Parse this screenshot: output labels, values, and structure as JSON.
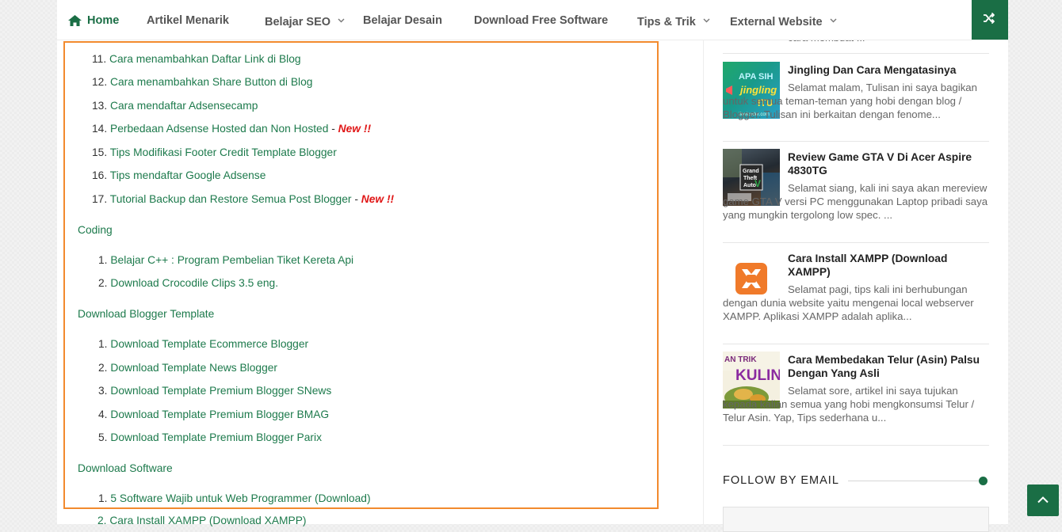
{
  "nav": {
    "home": "Home",
    "items": [
      "Artikel Menarik",
      "Belajar SEO",
      "Belajar Desain",
      "Download Free Software",
      "Tips & Trik",
      "External Website"
    ]
  },
  "content": {
    "list1": [
      {
        "num": "11.",
        "text": "Cara menambahkan Daftar Link di Blog"
      },
      {
        "num": "12.",
        "text": "Cara menambahkan Share Button di Blog"
      },
      {
        "num": "13.",
        "text": "Cara mendaftar Adsensecamp"
      },
      {
        "num": "14.",
        "text": "Perbedaan Adsense Hosted dan Non Hosted",
        "dash": " - ",
        "tag": "New !!"
      },
      {
        "num": "15.",
        "text": "Tips Modifikasi Footer Credit Template Blogger"
      },
      {
        "num": "16.",
        "text": "Tips mendaftar Google Adsense"
      },
      {
        "num": "17.",
        "text": "Tutorial Backup dan Restore Semua Post Blogger",
        "dash": " - ",
        "tag": "New !!"
      }
    ],
    "section_coding": "Coding",
    "coding": [
      {
        "num": "1.",
        "text": "Belajar C++ : Program Pembelian Tiket Kereta Api"
      },
      {
        "num": "2.",
        "text": "Download Crocodile Clips 3.5 eng."
      }
    ],
    "section_template": "Download Blogger Template",
    "templates": [
      {
        "num": "1.",
        "text": "Download Template Ecommerce Blogger"
      },
      {
        "num": "2.",
        "text": "Download Template News Blogger"
      },
      {
        "num": "3.",
        "text": "Download Template Premium Blogger SNews"
      },
      {
        "num": "4.",
        "text": "Download Template Premium Blogger BMAG"
      },
      {
        "num": "5.",
        "text": "Download Template Premium Blogger Parix"
      }
    ],
    "section_software": "Download Software",
    "software": [
      {
        "num": "1.",
        "text": "5 Software Wajib untuk Web Programmer (Download)"
      }
    ],
    "below_item": "2. Cara Install XAMPP (Download XAMPP)"
  },
  "sidebar": {
    "truncated": "cara membuat ...",
    "posts": [
      {
        "title": "Jingling Dan Cara Mengatasinya",
        "text": "Selamat malam, Tulisan ini saya bagikan untuk semua teman-teman yang hobi dengan blog / Blogger. Tulisan ini berkaitan dengan fenome...",
        "thumb_text": "APA SIH jingling ITU?",
        "thumb_caption": "ifeelcoder.com"
      },
      {
        "title": "Review Game GTA V Di Acer Aspire 4830TG",
        "text": "Selamat siang, kali ini saya akan mereview game GTA V versi PC menggunakan Laptop pribadi saya yang mungkin tergolong low spec. ...",
        "thumb_text": "Grand Theft Auto V"
      },
      {
        "title": "Cara Install XAMPP (Download XAMPP)",
        "text": "Selamat pagi, tips kali ini berhubungan dengan dunia website yaitu mengenai local webserver XAMPP. Aplikasi XAMPP adalah aplika..."
      },
      {
        "title": "Cara Membedakan Telur (Asin) Palsu Dengan Yang Asli",
        "text": "Selamat sore, artikel ini saya tujukan kepada kalian semua yang hobi mengkonsumsi Telur / Telur Asin. Yap, Tips sederhana u...",
        "thumb_text": "AN TRIK KULIN"
      }
    ],
    "follow_title": "FOLLOW BY EMAIL"
  },
  "colors": {
    "brand": "#1a6e45",
    "highlight_border": "#f28a2e",
    "new_tag": "#e01616"
  }
}
